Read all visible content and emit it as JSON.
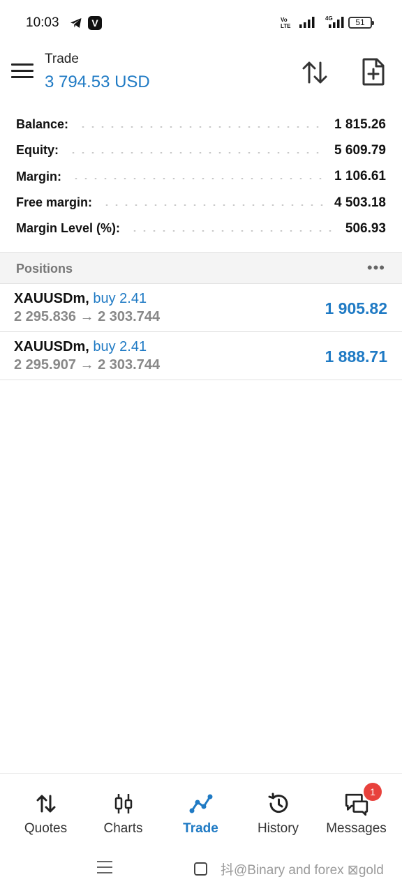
{
  "status": {
    "time": "10:03",
    "volte": "Vo LTE",
    "network": "4G",
    "battery": "51"
  },
  "appbar": {
    "title": "Trade",
    "balance": "3 794.53 USD"
  },
  "summary": [
    {
      "label": "Balance:",
      "value": "1 815.26"
    },
    {
      "label": "Equity:",
      "value": "5 609.79"
    },
    {
      "label": "Margin:",
      "value": "1 106.61"
    },
    {
      "label": "Free margin:",
      "value": "4 503.18"
    },
    {
      "label": "Margin Level (%):",
      "value": "506.93"
    }
  ],
  "positions_header": {
    "title": "Positions",
    "more": "•••"
  },
  "positions": [
    {
      "symbol": "XAUUSDm,",
      "side": "buy 2.41",
      "prices": "2 295.836 → 2 303.744",
      "profit": "1 905.82"
    },
    {
      "symbol": "XAUUSDm,",
      "side": "buy 2.41",
      "prices": "2 295.907 → 2 303.744",
      "profit": "1 888.71"
    }
  ],
  "nav": {
    "items": [
      {
        "label": "Quotes",
        "icon": "quotes-icon"
      },
      {
        "label": "Charts",
        "icon": "charts-icon"
      },
      {
        "label": "Trade",
        "icon": "trade-icon"
      },
      {
        "label": "History",
        "icon": "history-icon"
      },
      {
        "label": "Messages",
        "icon": "messages-icon"
      }
    ],
    "active": "Trade",
    "messages_badge": "1"
  },
  "watermark": "抖@Binary and forex ⊠gold",
  "colors": {
    "accent": "#1f7ac4",
    "badge": "#e8413c",
    "section_bg": "#f4f4f4"
  }
}
